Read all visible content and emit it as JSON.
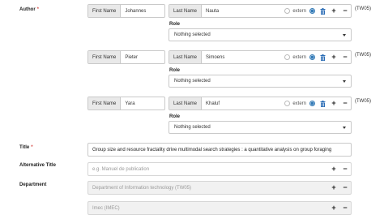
{
  "labels": {
    "author": "Author",
    "required_mark": "*",
    "title": "Title",
    "alternative_title": "Alternative Title",
    "department": "Department",
    "role": "Role"
  },
  "authors": [
    {
      "first_name_label": "First Name",
      "first_name": "Johannes",
      "last_name_label": "Last Name",
      "last_name": "Nauta",
      "extern_label": "extern",
      "role_value": "Nothing selected",
      "badge": "(TW05)"
    },
    {
      "first_name_label": "First Name",
      "first_name": "Pieter",
      "last_name_label": "Last Name",
      "last_name": "Simoens",
      "extern_label": "extern",
      "role_value": "Nothing selected",
      "badge": "(TW05)"
    },
    {
      "first_name_label": "First Name",
      "first_name": "Yara",
      "last_name_label": "Last Name",
      "last_name": "Khaluf",
      "extern_label": "extern",
      "role_value": "Nothing selected",
      "badge": "(TW05)"
    }
  ],
  "title_value": "Group size and resource fractality drive multimodal search strategies : a quantitative analysis on group foraging",
  "alternative_title_placeholder": "e.g. Manuel de publication",
  "departments": [
    "Department of Information technology (TW05)",
    "Imec (IMEC)"
  ],
  "buttons": {
    "plus": "+",
    "minus": "−"
  },
  "icons": {
    "trash": "trash-icon",
    "caret": "caret-down-icon"
  },
  "colors": {
    "required": "#d9534f",
    "accent": "#337ab7",
    "addon_bg": "#e9e9e9",
    "disabled_bg": "#f1f1f1"
  }
}
